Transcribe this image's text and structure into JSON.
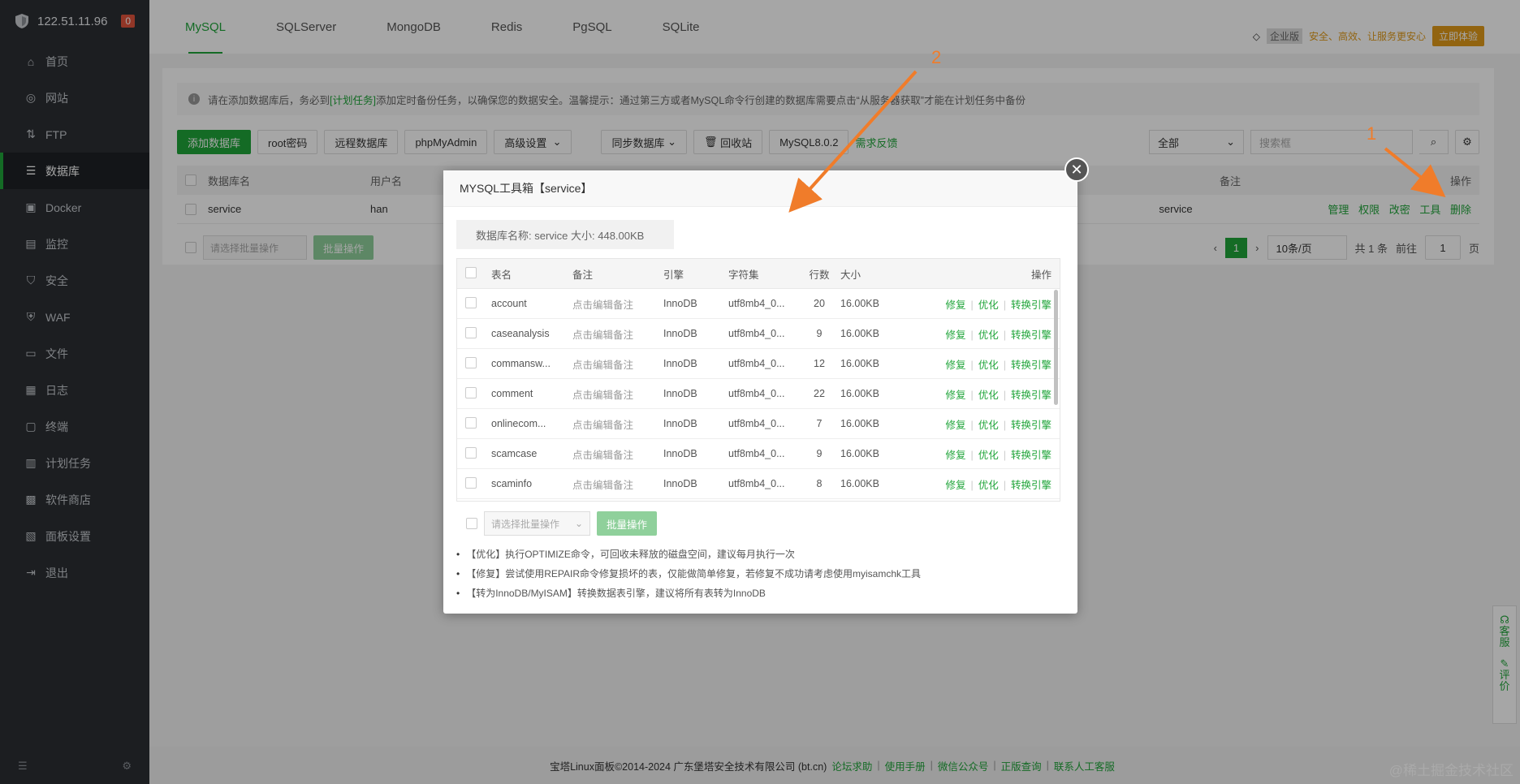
{
  "sidebar": {
    "ip": "122.51.11.96",
    "badge": "0",
    "items": [
      {
        "label": "首页"
      },
      {
        "label": "网站"
      },
      {
        "label": "FTP"
      },
      {
        "label": "数据库"
      },
      {
        "label": "Docker"
      },
      {
        "label": "监控"
      },
      {
        "label": "安全"
      },
      {
        "label": "WAF"
      },
      {
        "label": "文件"
      },
      {
        "label": "日志"
      },
      {
        "label": "终端"
      },
      {
        "label": "计划任务"
      },
      {
        "label": "软件商店"
      },
      {
        "label": "面板设置"
      },
      {
        "label": "退出"
      }
    ]
  },
  "tabs": [
    "MySQL",
    "SQLServer",
    "MongoDB",
    "Redis",
    "PgSQL",
    "SQLite"
  ],
  "enterprise": {
    "badge": "企业版",
    "text": "安全、高效、让服务更安心",
    "button": "立即体验"
  },
  "notice": {
    "pre": "请在添加数据库后，务必到",
    "link": "[计划任务]",
    "post": "添加定时备份任务，以确保您的数据安全。温馨提示：通过第三方或者MySQL命令行创建的数据库需要点击“从服务器获取”才能在计划任务中备份"
  },
  "toolbar": {
    "add": "添加数据库",
    "root": "root密码",
    "remote": "远程数据库",
    "pma": "phpMyAdmin",
    "advanced": "高级设置",
    "sync": "同步数据库",
    "recycle": "回收站",
    "version": "MySQL8.0.2",
    "feedback": "需求反馈",
    "filter": "全部",
    "search_placeholder": "搜索框"
  },
  "db_table": {
    "headers": {
      "name": "数据库名",
      "user": "用户名",
      "remark": "备注",
      "ops": "操作"
    },
    "row": {
      "name": "service",
      "user": "han",
      "remark": "service",
      "ops": [
        "管理",
        "权限",
        "改密",
        "工具",
        "删除"
      ]
    }
  },
  "pager": {
    "batch_placeholder": "请选择批量操作",
    "batch_btn": "批量操作",
    "page": "1",
    "per": "10条/页",
    "total": "共 1 条",
    "goto": "前往",
    "goto_val": "1",
    "unit": "页"
  },
  "modal": {
    "title": "MYSQL工具箱【service】",
    "info": "数据库名称: service 大小: 448.00KB",
    "headers": {
      "name": "表名",
      "remark": "备注",
      "engine": "引擎",
      "charset": "字符集",
      "rows": "行数",
      "size": "大小",
      "ops": "操作"
    },
    "rows": [
      {
        "name": "account",
        "remark": "点击编辑备注",
        "engine": "InnoDB",
        "charset": "utf8mb4_0...",
        "rows": "20",
        "size": "16.00KB"
      },
      {
        "name": "caseanalysis",
        "remark": "点击编辑备注",
        "engine": "InnoDB",
        "charset": "utf8mb4_0...",
        "rows": "9",
        "size": "16.00KB"
      },
      {
        "name": "commansw...",
        "remark": "点击编辑备注",
        "engine": "InnoDB",
        "charset": "utf8mb4_0...",
        "rows": "12",
        "size": "16.00KB"
      },
      {
        "name": "comment",
        "remark": "点击编辑备注",
        "engine": "InnoDB",
        "charset": "utf8mb4_0...",
        "rows": "22",
        "size": "16.00KB"
      },
      {
        "name": "onlinecom...",
        "remark": "点击编辑备注",
        "engine": "InnoDB",
        "charset": "utf8mb4_0...",
        "rows": "7",
        "size": "16.00KB"
      },
      {
        "name": "scamcase",
        "remark": "点击编辑备注",
        "engine": "InnoDB",
        "charset": "utf8mb4_0...",
        "rows": "9",
        "size": "16.00KB"
      },
      {
        "name": "scaminfo",
        "remark": "点击编辑备注",
        "engine": "InnoDB",
        "charset": "utf8mb4_0...",
        "rows": "8",
        "size": "16.00KB"
      }
    ],
    "ops": {
      "repair": "修复",
      "optimize": "优化",
      "convert": "转换引擎"
    },
    "batch_placeholder": "请选择批量操作",
    "batch_btn": "批量操作",
    "tips": [
      "【优化】执行OPTIMIZE命令，可回收未释放的磁盘空间，建议每月执行一次",
      "【修复】尝试使用REPAIR命令修复损坏的表，仅能做简单修复，若修复不成功请考虑使用myisamchk工具",
      "【转为InnoDB/MyISAM】转换数据表引擎，建议将所有表转为InnoDB"
    ]
  },
  "footer": {
    "copyright": "宝塔Linux面板©2014-2024 广东堡塔安全技术有限公司 (bt.cn)",
    "links": [
      "论坛求助",
      "使用手册",
      "微信公众号",
      "正版查询",
      "联系人工客服"
    ]
  },
  "side_float": {
    "service": "客服",
    "review": "评价"
  },
  "annotations": {
    "n1": "1",
    "n2": "2"
  },
  "watermark": "@稀土掘金技术社区",
  "colors": {
    "accent": "#20a53a",
    "sidebar": "#2b2e33",
    "arrow": "#f07c2a"
  }
}
